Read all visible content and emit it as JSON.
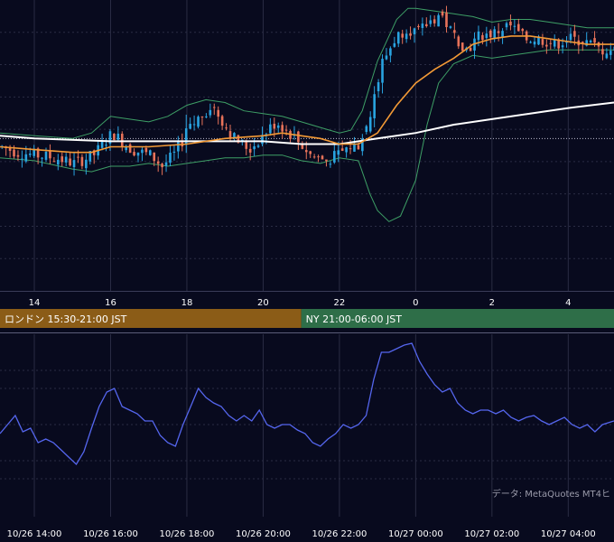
{
  "colors": {
    "background": "#080a1e",
    "grid": "#2a2c44",
    "candle_up": "#29a3e0",
    "candle_down": "#e8735a",
    "ma_short": "#f39a36",
    "ma_long": "#ffffff",
    "bollinger": "#3e9f66",
    "rsi_line": "#5566ee",
    "session_tokyo": "#2b5e8f",
    "session_london": "#8b5c17",
    "session_ny": "#2e6e48"
  },
  "sessions": [
    {
      "label": "",
      "color": "#2b5e8f",
      "start": 0,
      "end": 7.5
    },
    {
      "label": "ロンドン 15:30-21:00 JST",
      "color": "#8b5c17",
      "start": 7.5,
      "end": 21
    },
    {
      "label": "NY 21:00-06:00 JST",
      "color": "#2e6e48",
      "start": 21,
      "end": 30
    }
  ],
  "credit": "データ: MetaQuotes MT4ヒ",
  "chart_data": [
    {
      "type": "candlestick",
      "x_unit": "hours (10/26 14:00 = 14, 10/27 00:00 = 24)",
      "xlim": [
        13.1,
        29.2
      ],
      "xticks": [
        "14",
        "16",
        "18",
        "20",
        "22",
        "0",
        "2",
        "4"
      ],
      "xtick_values": [
        14,
        16,
        18,
        20,
        22,
        24,
        26,
        28
      ],
      "reference_line_y": 0.5,
      "ylim": [
        -0.05,
        1.0
      ],
      "price_path": [
        [
          13.1,
          0.47
        ],
        [
          13.5,
          0.45
        ],
        [
          14.0,
          0.44
        ],
        [
          14.5,
          0.43
        ],
        [
          15.0,
          0.41
        ],
        [
          15.5,
          0.44
        ],
        [
          16.0,
          0.52
        ],
        [
          16.5,
          0.46
        ],
        [
          17.0,
          0.44
        ],
        [
          17.3,
          0.4
        ],
        [
          17.6,
          0.44
        ],
        [
          18.0,
          0.53
        ],
        [
          18.3,
          0.58
        ],
        [
          18.6,
          0.62
        ],
        [
          18.9,
          0.56
        ],
        [
          19.2,
          0.5
        ],
        [
          19.6,
          0.46
        ],
        [
          20.0,
          0.52
        ],
        [
          20.3,
          0.56
        ],
        [
          20.8,
          0.5
        ],
        [
          21.2,
          0.44
        ],
        [
          21.6,
          0.42
        ],
        [
          21.9,
          0.44
        ],
        [
          22.2,
          0.47
        ],
        [
          22.5,
          0.48
        ],
        [
          22.7,
          0.56
        ],
        [
          22.9,
          0.65
        ],
        [
          23.1,
          0.78
        ],
        [
          23.4,
          0.86
        ],
        [
          23.7,
          0.9
        ],
        [
          24.0,
          0.88
        ],
        [
          24.3,
          0.92
        ],
        [
          24.6,
          0.95
        ],
        [
          24.9,
          0.88
        ],
        [
          25.3,
          0.82
        ],
        [
          25.6,
          0.87
        ],
        [
          26.0,
          0.88
        ],
        [
          26.4,
          0.91
        ],
        [
          26.8,
          0.86
        ],
        [
          27.2,
          0.86
        ],
        [
          27.6,
          0.84
        ],
        [
          28.0,
          0.86
        ],
        [
          28.4,
          0.85
        ],
        [
          28.8,
          0.82
        ],
        [
          29.2,
          0.82
        ]
      ],
      "ma_short_path": [
        [
          13.1,
          0.47
        ],
        [
          14.0,
          0.46
        ],
        [
          15.0,
          0.45
        ],
        [
          15.5,
          0.45
        ],
        [
          16.0,
          0.47
        ],
        [
          17.0,
          0.47
        ],
        [
          18.0,
          0.48
        ],
        [
          19.0,
          0.5
        ],
        [
          20.0,
          0.51
        ],
        [
          20.5,
          0.52
        ],
        [
          21.0,
          0.51
        ],
        [
          21.5,
          0.5
        ],
        [
          22.0,
          0.48
        ],
        [
          22.5,
          0.48
        ],
        [
          23.0,
          0.52
        ],
        [
          23.5,
          0.62
        ],
        [
          24.0,
          0.7
        ],
        [
          24.5,
          0.75
        ],
        [
          25.0,
          0.79
        ],
        [
          25.5,
          0.84
        ],
        [
          26.0,
          0.86
        ],
        [
          26.5,
          0.87
        ],
        [
          27.0,
          0.87
        ],
        [
          27.5,
          0.86
        ],
        [
          28.0,
          0.85
        ],
        [
          28.5,
          0.84
        ],
        [
          29.2,
          0.84
        ]
      ],
      "ma_long_path": [
        [
          13.1,
          0.51
        ],
        [
          14.0,
          0.5
        ],
        [
          16.0,
          0.49
        ],
        [
          18.0,
          0.49
        ],
        [
          20.0,
          0.49
        ],
        [
          21.0,
          0.48
        ],
        [
          22.0,
          0.48
        ],
        [
          22.5,
          0.49
        ],
        [
          23.0,
          0.5
        ],
        [
          24.0,
          0.52
        ],
        [
          25.0,
          0.55
        ],
        [
          26.0,
          0.57
        ],
        [
          27.0,
          0.59
        ],
        [
          28.0,
          0.61
        ],
        [
          29.2,
          0.63
        ]
      ],
      "boll_upper_path": [
        [
          13.1,
          0.52
        ],
        [
          14.0,
          0.51
        ],
        [
          15.0,
          0.5
        ],
        [
          15.5,
          0.52
        ],
        [
          16.0,
          0.58
        ],
        [
          16.5,
          0.57
        ],
        [
          17.0,
          0.56
        ],
        [
          17.5,
          0.58
        ],
        [
          18.0,
          0.62
        ],
        [
          18.5,
          0.64
        ],
        [
          19.0,
          0.63
        ],
        [
          19.5,
          0.6
        ],
        [
          20.0,
          0.59
        ],
        [
          20.5,
          0.58
        ],
        [
          21.0,
          0.56
        ],
        [
          21.5,
          0.54
        ],
        [
          22.0,
          0.52
        ],
        [
          22.3,
          0.53
        ],
        [
          22.6,
          0.6
        ],
        [
          23.0,
          0.78
        ],
        [
          23.5,
          0.93
        ],
        [
          23.8,
          0.97
        ],
        [
          24.0,
          0.97
        ],
        [
          24.5,
          0.96
        ],
        [
          25.0,
          0.95
        ],
        [
          25.5,
          0.94
        ],
        [
          26.0,
          0.92
        ],
        [
          26.5,
          0.93
        ],
        [
          27.0,
          0.93
        ],
        [
          27.5,
          0.92
        ],
        [
          28.0,
          0.91
        ],
        [
          28.5,
          0.9
        ],
        [
          29.2,
          0.9
        ]
      ],
      "boll_lower_path": [
        [
          13.1,
          0.43
        ],
        [
          14.0,
          0.42
        ],
        [
          15.0,
          0.39
        ],
        [
          15.5,
          0.38
        ],
        [
          16.0,
          0.4
        ],
        [
          16.5,
          0.4
        ],
        [
          17.0,
          0.41
        ],
        [
          17.5,
          0.4
        ],
        [
          18.0,
          0.41
        ],
        [
          18.5,
          0.42
        ],
        [
          19.0,
          0.43
        ],
        [
          19.5,
          0.43
        ],
        [
          20.0,
          0.44
        ],
        [
          20.5,
          0.44
        ],
        [
          21.0,
          0.42
        ],
        [
          21.5,
          0.41
        ],
        [
          22.0,
          0.43
        ],
        [
          22.5,
          0.42
        ],
        [
          22.8,
          0.3
        ],
        [
          23.0,
          0.24
        ],
        [
          23.3,
          0.2
        ],
        [
          23.6,
          0.22
        ],
        [
          24.0,
          0.35
        ],
        [
          24.3,
          0.55
        ],
        [
          24.6,
          0.7
        ],
        [
          25.0,
          0.77
        ],
        [
          25.5,
          0.8
        ],
        [
          26.0,
          0.79
        ],
        [
          26.5,
          0.8
        ],
        [
          27.0,
          0.81
        ],
        [
          27.5,
          0.82
        ],
        [
          28.0,
          0.82
        ],
        [
          29.2,
          0.82
        ]
      ]
    },
    {
      "type": "line",
      "x_unit": "hours (10/26 14:00 = 14, 10/27 00:00 = 24)",
      "xlim": [
        13.1,
        29.2
      ],
      "ylim": [
        0,
        100
      ],
      "xticks": [
        "10/26 14:00",
        "10/26 16:00",
        "10/26 18:00",
        "10/26 20:00",
        "10/26 22:00",
        "10/27 00:00",
        "10/27 02:00",
        "10/27 04:00"
      ],
      "xtick_values": [
        14,
        16,
        18,
        20,
        22,
        24,
        26,
        28
      ],
      "levels": [
        80,
        70,
        50,
        30,
        20
      ],
      "series": [
        {
          "color": "#5566ee",
          "points": [
            [
              13.1,
              45
            ],
            [
              13.3,
              50
            ],
            [
              13.5,
              55
            ],
            [
              13.7,
              46
            ],
            [
              13.9,
              48
            ],
            [
              14.1,
              40
            ],
            [
              14.3,
              42
            ],
            [
              14.5,
              40
            ],
            [
              14.7,
              36
            ],
            [
              14.9,
              32
            ],
            [
              15.1,
              28
            ],
            [
              15.3,
              35
            ],
            [
              15.5,
              48
            ],
            [
              15.7,
              60
            ],
            [
              15.9,
              68
            ],
            [
              16.1,
              70
            ],
            [
              16.3,
              60
            ],
            [
              16.5,
              58
            ],
            [
              16.7,
              56
            ],
            [
              16.9,
              52
            ],
            [
              17.1,
              52
            ],
            [
              17.3,
              44
            ],
            [
              17.5,
              40
            ],
            [
              17.7,
              38
            ],
            [
              17.9,
              50
            ],
            [
              18.1,
              60
            ],
            [
              18.3,
              70
            ],
            [
              18.5,
              65
            ],
            [
              18.7,
              62
            ],
            [
              18.9,
              60
            ],
            [
              19.1,
              55
            ],
            [
              19.3,
              52
            ],
            [
              19.5,
              55
            ],
            [
              19.7,
              52
            ],
            [
              19.9,
              58
            ],
            [
              20.1,
              50
            ],
            [
              20.3,
              48
            ],
            [
              20.5,
              50
            ],
            [
              20.7,
              50
            ],
            [
              20.9,
              47
            ],
            [
              21.1,
              45
            ],
            [
              21.3,
              40
            ],
            [
              21.5,
              38
            ],
            [
              21.7,
              42
            ],
            [
              21.9,
              45
            ],
            [
              22.1,
              50
            ],
            [
              22.3,
              48
            ],
            [
              22.5,
              50
            ],
            [
              22.7,
              55
            ],
            [
              22.9,
              75
            ],
            [
              23.1,
              90
            ],
            [
              23.3,
              90
            ],
            [
              23.5,
              92
            ],
            [
              23.7,
              94
            ],
            [
              23.9,
              95
            ],
            [
              24.1,
              85
            ],
            [
              24.3,
              78
            ],
            [
              24.5,
              72
            ],
            [
              24.7,
              68
            ],
            [
              24.9,
              70
            ],
            [
              25.1,
              62
            ],
            [
              25.3,
              58
            ],
            [
              25.5,
              56
            ],
            [
              25.7,
              58
            ],
            [
              25.9,
              58
            ],
            [
              26.1,
              56
            ],
            [
              26.3,
              58
            ],
            [
              26.5,
              54
            ],
            [
              26.7,
              52
            ],
            [
              26.9,
              54
            ],
            [
              27.1,
              55
            ],
            [
              27.3,
              52
            ],
            [
              27.5,
              50
            ],
            [
              27.7,
              52
            ],
            [
              27.9,
              54
            ],
            [
              28.1,
              50
            ],
            [
              28.3,
              48
            ],
            [
              28.5,
              50
            ],
            [
              28.7,
              46
            ],
            [
              28.9,
              50
            ],
            [
              29.2,
              52
            ]
          ]
        }
      ]
    }
  ]
}
